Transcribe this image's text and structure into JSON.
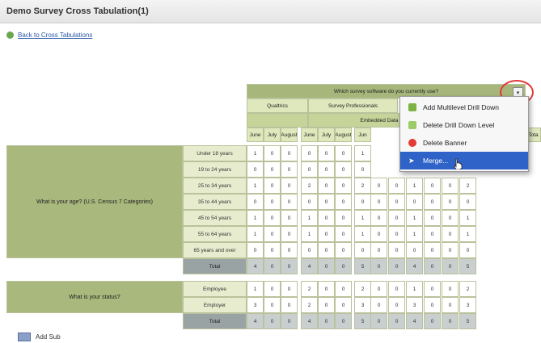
{
  "title": "Demo Survey Cross Tabulation(1)",
  "back_link": "Back to Cross Tabulations",
  "banner_question": "Which survey software do you currently use?",
  "col_groups": [
    "Qualtrics",
    "Survey Professionals"
  ],
  "embedded_label": "Embedded Data Fi",
  "months": [
    "June",
    "July",
    "August",
    "June",
    "July",
    "August",
    "Jun"
  ],
  "right_header": "Tota",
  "q1": {
    "label": "What is your age? (U.S. Census 7 Categories)",
    "rows": [
      {
        "label": "Under 18 years",
        "values": [
          "1",
          "0",
          "0",
          "0",
          "0",
          "0",
          "1"
        ]
      },
      {
        "label": "19 to 24 years",
        "values": [
          "0",
          "0",
          "0",
          "0",
          "0",
          "0",
          "0"
        ]
      },
      {
        "label": "25 to 34 years",
        "values": [
          "1",
          "0",
          "0",
          "2",
          "0",
          "0",
          "2",
          "0",
          "0",
          "1",
          "0",
          "0",
          "2"
        ]
      },
      {
        "label": "35 to 44 years",
        "values": [
          "0",
          "0",
          "0",
          "0",
          "0",
          "0",
          "0",
          "0",
          "0",
          "0",
          "0",
          "0",
          "0"
        ]
      },
      {
        "label": "45 to 54 years",
        "values": [
          "1",
          "0",
          "0",
          "1",
          "0",
          "0",
          "1",
          "0",
          "0",
          "1",
          "0",
          "0",
          "1"
        ]
      },
      {
        "label": "55 to 64 years",
        "values": [
          "1",
          "0",
          "0",
          "1",
          "0",
          "0",
          "1",
          "0",
          "0",
          "1",
          "0",
          "0",
          "1"
        ]
      },
      {
        "label": "65 years and over",
        "values": [
          "0",
          "0",
          "0",
          "0",
          "0",
          "0",
          "0",
          "0",
          "0",
          "0",
          "0",
          "0",
          "0"
        ]
      }
    ],
    "total_label": "Total",
    "total_values": [
      "4",
      "0",
      "0",
      "4",
      "0",
      "0",
      "5",
      "0",
      "0",
      "4",
      "0",
      "0",
      "5"
    ]
  },
  "q2": {
    "label": "What is your status?",
    "rows": [
      {
        "label": "Employee",
        "values": [
          "1",
          "0",
          "0",
          "2",
          "0",
          "0",
          "2",
          "0",
          "0",
          "1",
          "0",
          "0",
          "2"
        ]
      },
      {
        "label": "Employer",
        "values": [
          "3",
          "0",
          "0",
          "2",
          "0",
          "0",
          "3",
          "0",
          "0",
          "3",
          "0",
          "0",
          "3"
        ]
      }
    ],
    "total_label": "Total",
    "total_values": [
      "4",
      "0",
      "0",
      "4",
      "0",
      "0",
      "5",
      "0",
      "0",
      "4",
      "0",
      "0",
      "5"
    ]
  },
  "menu": {
    "items": [
      {
        "label": "Add Multilevel Drill Down",
        "icon": "add-drill-icon",
        "color": "#7cb342"
      },
      {
        "label": "Delete Drill Down Level",
        "icon": "delete-drill-icon",
        "color": "#9ccc65"
      },
      {
        "label": "Delete Banner",
        "icon": "delete-banner-icon",
        "color": "#e53935"
      },
      {
        "label": "Merge...",
        "icon": "merge-icon",
        "color": "#ffffff"
      }
    ],
    "dropdown_glyph": "▾"
  },
  "add_sub": "Add Sub"
}
